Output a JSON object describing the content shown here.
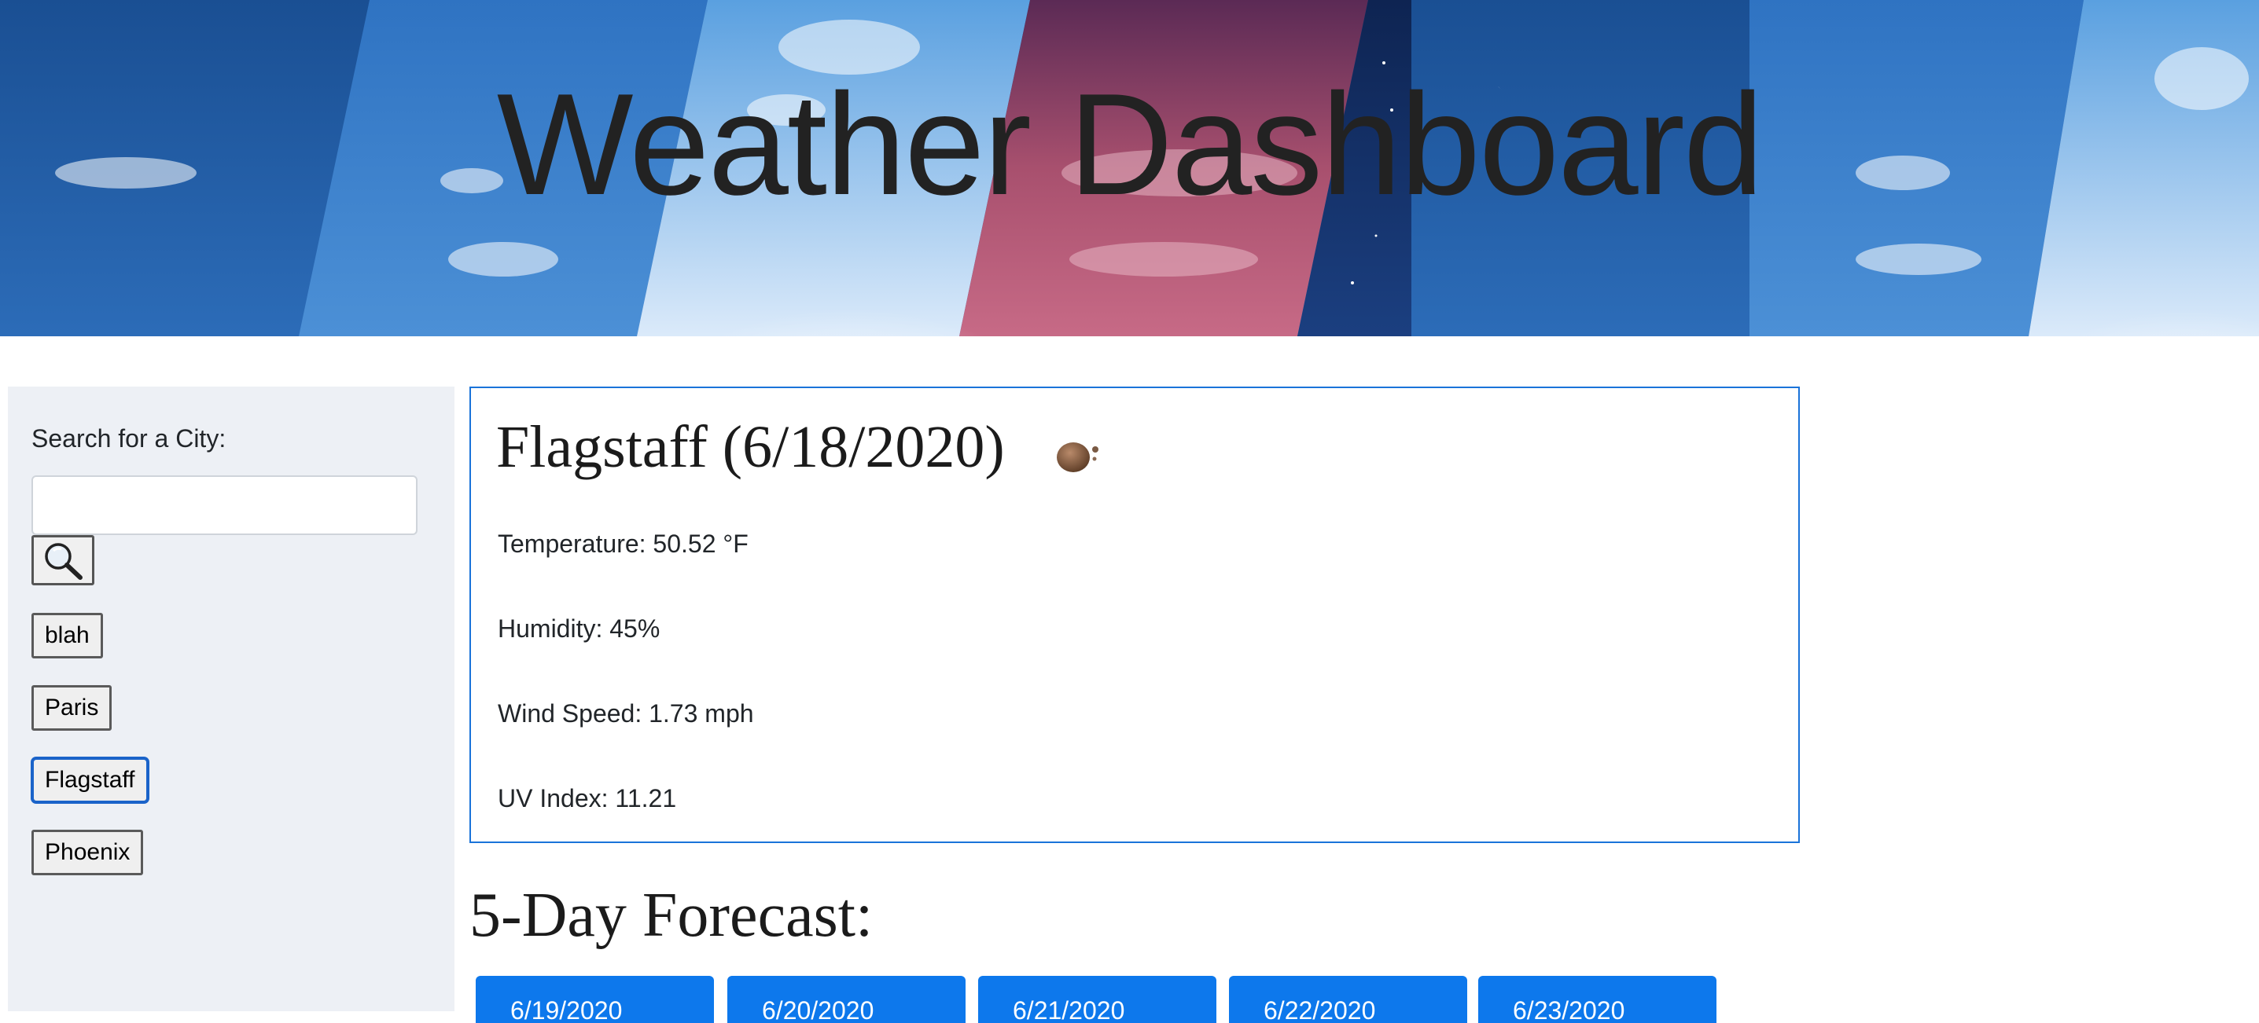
{
  "header": {
    "title": "Weather Dashboard"
  },
  "sidebar": {
    "search_label": "Search for a City:",
    "search_value": "",
    "search_placeholder": "",
    "search_button_icon": "magnifying-glass-icon",
    "cities": [
      "blah",
      "Paris",
      "Flagstaff",
      "Phoenix"
    ],
    "active_city": "Flagstaff"
  },
  "current": {
    "heading": "Flagstaff (6/18/2020)",
    "icon": "haze-icon",
    "temperature": "Temperature: 50.52 °F",
    "humidity": "Humidity: 45%",
    "wind_speed": "Wind Speed: 1.73 mph",
    "uv_index": "UV Index: 11.21"
  },
  "forecast": {
    "title": "5-Day Forecast:",
    "days": [
      {
        "date": "6/19/2020"
      },
      {
        "date": "6/20/2020"
      },
      {
        "date": "6/21/2020"
      },
      {
        "date": "6/22/2020"
      },
      {
        "date": "6/23/2020"
      }
    ]
  },
  "colors": {
    "accent": "#0d78ec",
    "card_border": "#1a73d9",
    "sidebar_bg": "#edf0f5"
  }
}
